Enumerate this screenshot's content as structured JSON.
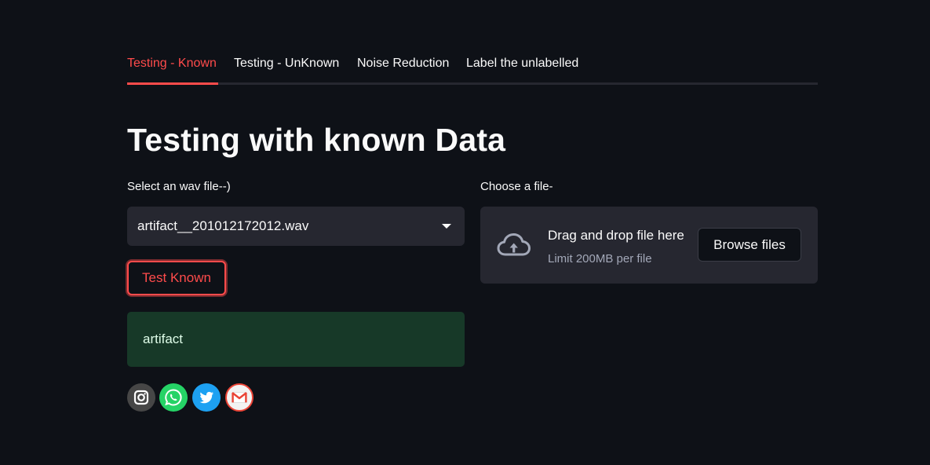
{
  "tabs": [
    {
      "label": "Testing - Known",
      "active": true
    },
    {
      "label": "Testing - UnKnown",
      "active": false
    },
    {
      "label": "Noise Reduction",
      "active": false
    },
    {
      "label": "Label the unlabelled",
      "active": false
    }
  ],
  "page_title": "Testing with known Data",
  "left": {
    "select_label": "Select an wav file--)",
    "select_value": "artifact__201012172012.wav",
    "test_button": "Test Known",
    "result_text": "artifact"
  },
  "right": {
    "uploader_label": "Choose a file-",
    "drag_text": "Drag and drop file here",
    "limit_text": "Limit 200MB per file",
    "browse_button": "Browse files"
  },
  "socials": [
    {
      "name": "instagram",
      "color": "#464646"
    },
    {
      "name": "whatsapp",
      "color": "#25d366"
    },
    {
      "name": "twitter",
      "color": "#1da1f2"
    },
    {
      "name": "gmail",
      "color": "#ea4335"
    }
  ],
  "colors": {
    "background": "#0e1117",
    "accent": "#ff4b4b",
    "surface": "#262730",
    "success_bg": "#173928"
  }
}
